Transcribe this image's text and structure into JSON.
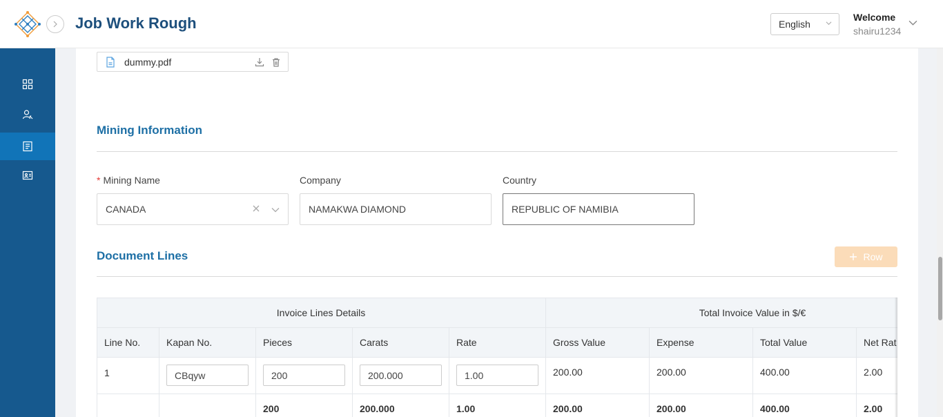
{
  "header": {
    "app_title": "Job Work Rough",
    "language": "English",
    "welcome": "Welcome",
    "username": "shairu1234"
  },
  "sidebar": {
    "items": [
      {
        "icon": "dashboard-icon"
      },
      {
        "icon": "users-icon"
      },
      {
        "icon": "document-list-icon",
        "active": true
      },
      {
        "icon": "id-card-icon"
      }
    ]
  },
  "attachment": {
    "file_name": "dummy.pdf"
  },
  "mining": {
    "section_title": "Mining Information",
    "mining_name_label": "Mining Name",
    "mining_name_value": "CANADA",
    "company_label": "Company",
    "company_value": "NAMAKWA DIAMOND",
    "country_label": "Country",
    "country_value": "REPUBLIC OF NAMIBIA"
  },
  "document_lines": {
    "section_title": "Document Lines",
    "add_row_label": "Row",
    "group_headers": {
      "invoice_lines": "Invoice Lines Details",
      "total_invoice": "Total Invoice Value in $/€"
    },
    "columns": [
      "Line No.",
      "Kapan No.",
      "Pieces",
      "Carats",
      "Rate",
      "Gross Value",
      "Expense",
      "Total Value",
      "Net Rat"
    ],
    "rows": [
      {
        "line_no": "1",
        "kapan_no": "CBqyw",
        "pieces": "200",
        "carats": "200.000",
        "rate": "1.00",
        "gross_value": "200.00",
        "expense": "200.00",
        "total_value": "400.00",
        "net_rate": "2.00"
      }
    ],
    "totals": {
      "pieces": "200",
      "carats": "200.000",
      "rate": "1.00",
      "gross_value": "200.00",
      "expense": "200.00",
      "total_value": "400.00",
      "net_rate": "2.00"
    }
  },
  "colors": {
    "sidebar_bg": "#16598e",
    "sidebar_active": "#1174b8",
    "title_blue": "#1d6fa5",
    "add_button_disabled": "#fbdcb9"
  }
}
